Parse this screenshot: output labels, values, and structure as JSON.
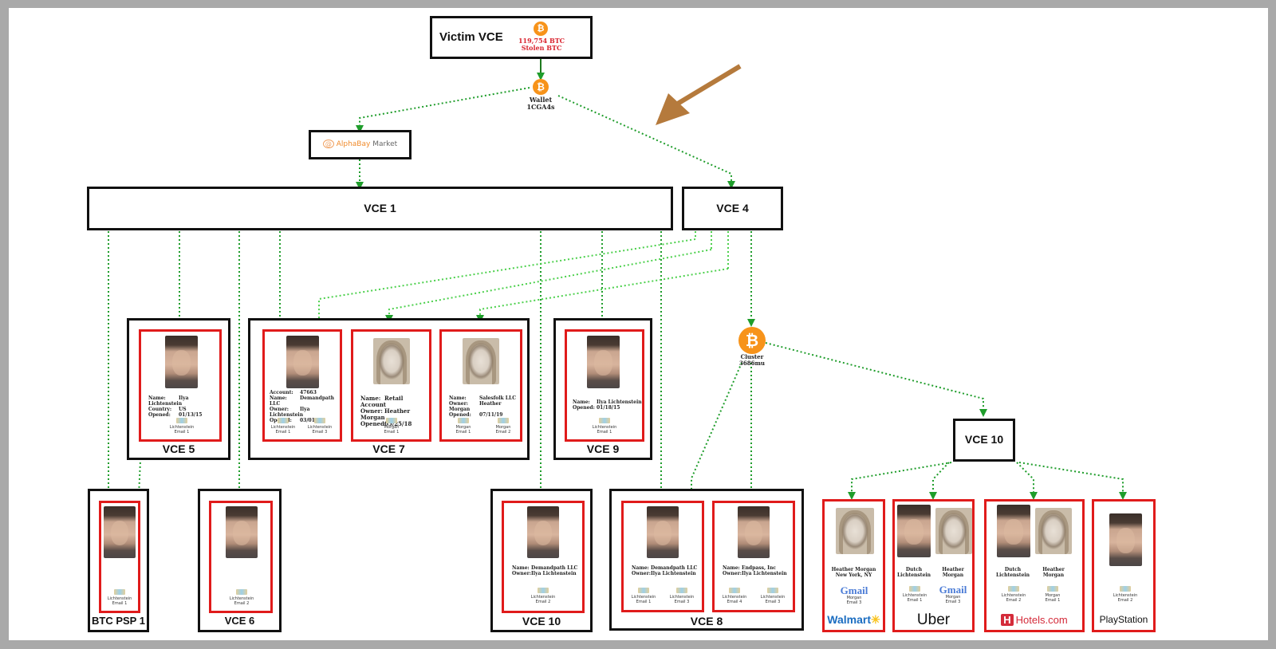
{
  "diagram": {
    "victim": {
      "title": "Victim VCE",
      "btc_amount": "119,754 BTC",
      "btc_caption": "Stolen BTC",
      "btc_glyph": "₿"
    },
    "wallet": {
      "line1": "Wallet",
      "line2": "1CGA4s",
      "glyph": "₿"
    },
    "market": {
      "icon": "@",
      "name_part1": "AlphaBay",
      "name_part2": "Market"
    },
    "vce1": {
      "title": "VCE 1"
    },
    "vce4": {
      "title": "VCE 4"
    },
    "cluster": {
      "line1": "Cluster",
      "line2": "3686mu",
      "glyph": "₿"
    },
    "vce5": {
      "title": "VCE 5",
      "card": {
        "rows": [
          {
            "k": "Name:",
            "v": "Ilya Lichtenstein"
          },
          {
            "k": "Country:",
            "v": "US"
          },
          {
            "k": "Opened:",
            "v": "01/13/15"
          }
        ],
        "emails": [
          {
            "owner": "Lichtenstein",
            "label": "Email 1"
          }
        ]
      }
    },
    "vce7": {
      "title": "VCE 7",
      "cards": [
        {
          "rows": [
            {
              "k": "Account:",
              "v": "47663"
            },
            {
              "k": "Name:",
              "v": "Demandpath LLC"
            },
            {
              "k": "Owner:",
              "v": "Ilya Lichtenstein"
            },
            {
              "k": "Opened:",
              "v": "03/01/17"
            }
          ],
          "emails": [
            {
              "owner": "Lichtenstein",
              "label": "Email 1"
            },
            {
              "owner": "Lichtenstein",
              "label": "Email 3"
            }
          ]
        },
        {
          "rows": [
            {
              "k": "Name:",
              "v": "Retail Account"
            },
            {
              "k": "Owner:",
              "v": "Heather Morgan"
            },
            {
              "k": "Opened:",
              "v": "05/25/18"
            }
          ],
          "emails": [
            {
              "owner": "Morgan",
              "label": "Email 1"
            }
          ]
        },
        {
          "rows": [
            {
              "k": "Name:",
              "v": "Salesfolk LLC"
            },
            {
              "k": "Owner:",
              "v": "Heather Morgan"
            },
            {
              "k": "Opened:",
              "v": "07/11/19"
            }
          ],
          "emails": [
            {
              "owner": "Morgan",
              "label": "Email 1"
            },
            {
              "owner": "Morgan",
              "label": "Email 2"
            }
          ]
        }
      ]
    },
    "vce9": {
      "title": "VCE 9",
      "card": {
        "rows": [
          {
            "k": "Name:",
            "v": "Ilya Lichtenstein"
          },
          {
            "k": "Opened:",
            "v": "01/18/15"
          }
        ],
        "emails": [
          {
            "owner": "Lichtenstein",
            "label": "Email 1"
          }
        ]
      }
    },
    "btcpsp1": {
      "title": "BTC PSP 1",
      "card": {
        "emails": [
          {
            "owner": "Lichtenstein",
            "label": "Email 1"
          }
        ]
      }
    },
    "vce6": {
      "title": "VCE 6",
      "card": {
        "emails": [
          {
            "owner": "Lichtenstein",
            "label": "Email 2"
          }
        ]
      }
    },
    "vce10_bottom": {
      "title": "VCE 10",
      "card": {
        "rows": [
          {
            "k": "Name:",
            "v": "Demandpath LLC"
          },
          {
            "k": "Owner:",
            "v": "Ilya Lichtenstein"
          }
        ],
        "emails": [
          {
            "owner": "Lichtenstein",
            "label": "Email 2"
          }
        ]
      }
    },
    "vce8": {
      "title": "VCE 8",
      "cards": [
        {
          "rows": [
            {
              "k": "Name:",
              "v": "Demandpath LLC"
            },
            {
              "k": "Owner:",
              "v": "Ilya Lichtenstein"
            }
          ],
          "emails": [
            {
              "owner": "Lichtenstein",
              "label": "Email 1"
            },
            {
              "owner": "Lichtenstein",
              "label": "Email 3"
            }
          ]
        },
        {
          "rows": [
            {
              "k": "Name:",
              "v": "Endpass, Inc"
            },
            {
              "k": "Owner:",
              "v": "Ilya Lichtenstein"
            }
          ],
          "emails": [
            {
              "owner": "Lichtenstein",
              "label": "Email 4"
            },
            {
              "owner": "Lichtenstein",
              "label": "Email 3"
            }
          ]
        }
      ]
    },
    "vce10_right": {
      "title": "VCE 10",
      "merchants": [
        {
          "brand": "Walmart",
          "brand_mark": "✳",
          "people": [
            {
              "name1": "Heather Morgan",
              "name2": "New York, NY"
            }
          ],
          "emails": [
            {
              "kind": "gmail",
              "owner": "Morgan",
              "label": "Email 3"
            }
          ]
        },
        {
          "brand": "Uber",
          "people": [
            {
              "name1": "Dutch",
              "name2": "Lichtenstein"
            },
            {
              "name1": "Heather",
              "name2": "Morgan"
            }
          ],
          "emails": [
            {
              "kind": "mail",
              "owner": "Lichtenstein",
              "label": "Email 1"
            },
            {
              "kind": "gmail",
              "owner": "Morgan",
              "label": "Email 3"
            }
          ]
        },
        {
          "brand": "Hotels.com",
          "brand_mark": "H",
          "people": [
            {
              "name1": "Dutch",
              "name2": "Lichtenstein"
            },
            {
              "name1": "Heather",
              "name2": "Morgan"
            }
          ],
          "emails": [
            {
              "kind": "mail",
              "owner": "Lichtenstein",
              "label": "Email 2"
            },
            {
              "kind": "mail",
              "owner": "Morgan",
              "label": "Email 1"
            }
          ]
        },
        {
          "brand": "PlayStation",
          "people": [],
          "emails": [
            {
              "kind": "mail",
              "owner": "Lichtenstein",
              "label": "Email 2"
            }
          ]
        }
      ]
    },
    "gmail_text": "Gmail",
    "colors": {
      "link_green": "#1f9d2b",
      "link_light_green": "#4cd04c",
      "card_red": "#e01b1b",
      "btc_orange": "#f7931a",
      "arrow_brown": "#b57a3c",
      "stolen_red": "#d9232e"
    }
  }
}
